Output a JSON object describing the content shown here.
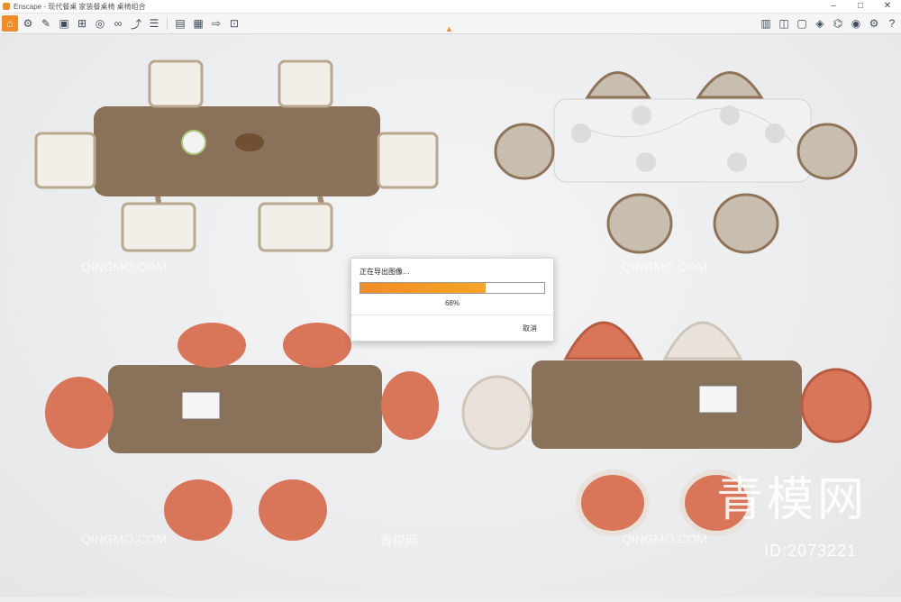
{
  "window": {
    "title": "Enscape - 现代餐桌 家装餐桌椅 桌椅组合",
    "minimize": "–",
    "maximize": "□",
    "close": "✕"
  },
  "toolbar": {
    "left_icons": [
      "home-icon",
      "cubes-icon",
      "paint-icon",
      "scene-icon",
      "bookmark-icon",
      "asset-icon",
      "binoculars-icon",
      "walk-icon",
      "layers-icon",
      "screenshot-icon",
      "export-video-icon",
      "batch-render-icon",
      "capture-icon"
    ],
    "right_icons": [
      "book-icon",
      "map-icon",
      "box-icon",
      "cube-icon",
      "asset-library-icon",
      "eye-icon",
      "settings-icon",
      "help-icon"
    ],
    "help_label": "?"
  },
  "dialog": {
    "message": "正在导出图像…",
    "progress": 0.68,
    "percent_label": "68%",
    "cancel_label": "取消"
  },
  "watermarks": {
    "brand_text": "青模网",
    "id_text": "ID:2073221",
    "site_text": "QINGMO.COM",
    "site_text_cn": "青模网"
  },
  "colors": {
    "accent": "#f28c28",
    "wood": "#8a7159",
    "orange_chair": "#d9765a",
    "marble": "#f1f1f1"
  }
}
